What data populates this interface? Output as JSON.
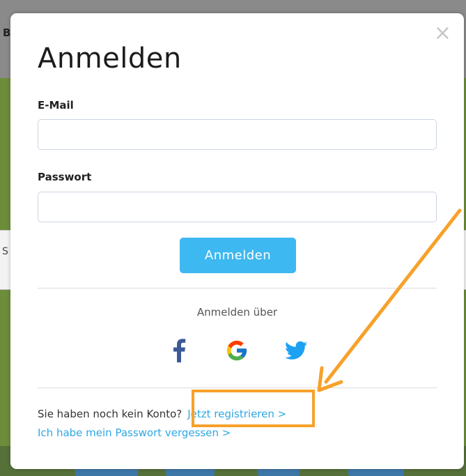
{
  "background": {
    "topbar_letter": "B",
    "strip_letter": "S"
  },
  "modal": {
    "close_symbol": "×",
    "title": "Anmelden",
    "email_label": "E-Mail",
    "email_value": "",
    "password_label": "Passwort",
    "password_value": "",
    "submit_label": "Anmelden",
    "social_caption": "Anmelden über",
    "social_icons": [
      "facebook-icon",
      "google-icon",
      "twitter-icon"
    ],
    "no_account_text": "Sie haben noch kein Konto?",
    "register_link": "Jetzt registrieren >",
    "forgot_link": "Ich habe mein Passwort vergessen >"
  },
  "colors": {
    "accent": "#3eb8f0",
    "link": "#2fa7e3",
    "annotation": "#f7a12a",
    "facebook": "#3b5998",
    "twitter": "#1da1f2"
  }
}
